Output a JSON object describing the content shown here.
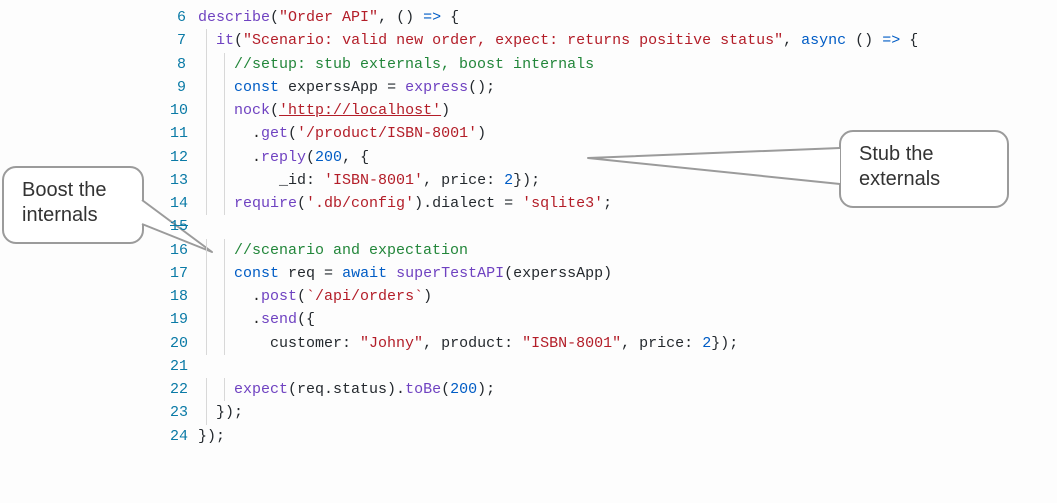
{
  "callouts": {
    "left_line1": "Boost the",
    "left_line2": "internals",
    "right_line1": "Stub the",
    "right_line2": "externals"
  },
  "lines": {
    "l6": {
      "num": "6"
    },
    "l7": {
      "num": "7"
    },
    "l8": {
      "num": "8"
    },
    "l9": {
      "num": "9"
    },
    "l10": {
      "num": "10"
    },
    "l11": {
      "num": "11"
    },
    "l12": {
      "num": "12"
    },
    "l13": {
      "num": "13"
    },
    "l14": {
      "num": "14"
    },
    "l15": {
      "num": "15"
    },
    "l16": {
      "num": "16"
    },
    "l17": {
      "num": "17"
    },
    "l18": {
      "num": "18"
    },
    "l19": {
      "num": "19"
    },
    "l20": {
      "num": "20"
    },
    "l21": {
      "num": "21"
    },
    "l22": {
      "num": "22"
    },
    "l23": {
      "num": "23"
    },
    "l24": {
      "num": "24"
    }
  },
  "code": {
    "describe": "describe",
    "orderApi": "\"Order API\"",
    "arrowOpen": ", () ",
    "fatArrow": "=>",
    "braceOpen": " {",
    "it": "it",
    "scenario": "\"Scenario: valid new order, expect: returns positive status\"",
    "asyncArrow": ", ",
    "async": "async",
    "arrowTail": " () ",
    "comment1": "//setup: stub externals, boost internals",
    "const": "const",
    "experss": " experssApp ",
    "eq": "= ",
    "express": "express",
    "unitEnd": "();",
    "nock": "nock",
    "nockOpen": "(",
    "localhost": "'http://localhost'",
    "close": ")",
    "dotGet": "get",
    "isbnPath": "'/product/ISBN-8001'",
    "dotReply": "reply",
    "replyArgs1": "(",
    "n200": "200",
    "replyArgs2": ", {",
    "idKey": "_id",
    "idVal": "'ISBN-8001'",
    "priceKey": "price",
    "n2": "2",
    "closeObj": "});",
    "require": "require",
    "dbcfg": "'.db/config'",
    "dialect": ").dialect ",
    "sqlite": "'sqlite3'",
    "semi": ";",
    "comment2": "//scenario and expectation",
    "req": " req ",
    "await": "await",
    "superTest": "superTestAPI",
    "stArg": "(experssApp)",
    "post": "post",
    "postPath": "`/api/orders`",
    "send": "send",
    "sendOpen": "({",
    "customerKey": "customer",
    "customerVal": "\"Johny\"",
    "productKey": "product",
    "productVal": "\"ISBN-8001\"",
    "expect": "expect",
    "reqStatus": "(req.status).",
    "toBe": "toBe",
    "toBeArg": "(",
    "closeParenSemi": ");",
    "closeIt": "});",
    "closeDesc": "});"
  }
}
